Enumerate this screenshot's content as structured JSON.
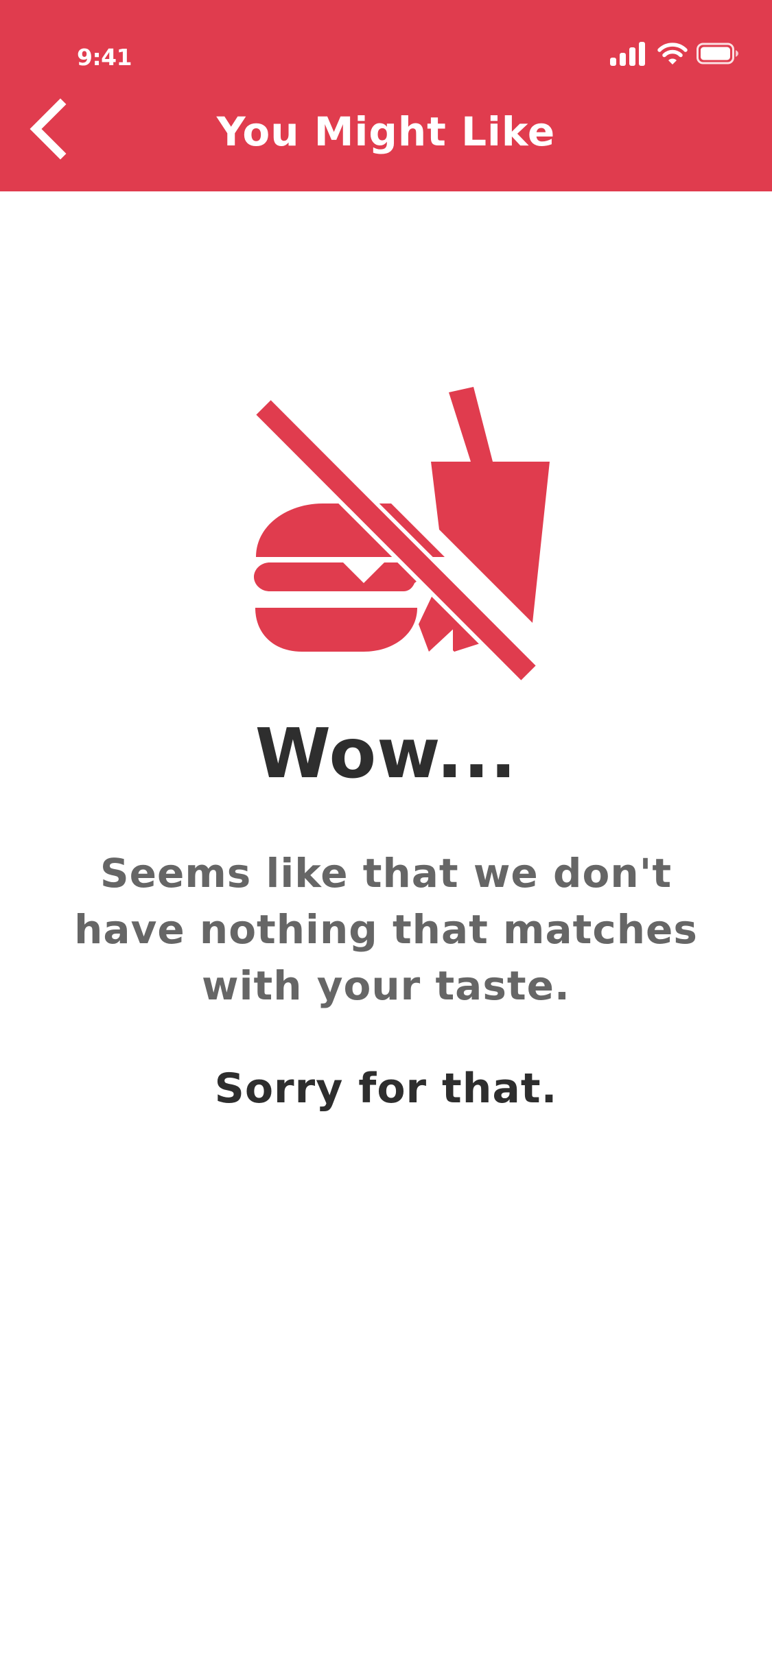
{
  "status_bar": {
    "time": "9:41",
    "icons": [
      "signal-icon",
      "wifi-icon",
      "battery-icon"
    ]
  },
  "header": {
    "title": "You Might Like",
    "back_icon": "chevron-left-icon",
    "background_color": "#E03C4E"
  },
  "empty_state": {
    "icon": "no-food-icon",
    "title": "Wow...",
    "message": "Seems like that we don't have nothing that matches with your taste.",
    "apology": "Sorry for that.",
    "accent_color": "#E03C4E"
  }
}
